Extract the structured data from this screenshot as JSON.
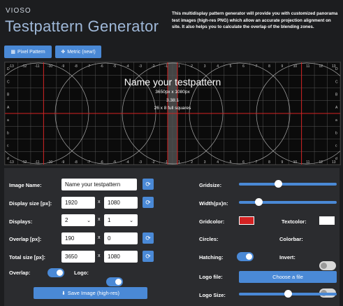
{
  "header": {
    "brand": "VIOSO",
    "title": "Testpattern Generator",
    "description": "This multidisplay pattern generator will provide you with customized panorama test images (high-res PNG) which allow an accurate projection alignment on site. It also helps you to calculate the overlap of the blending zones."
  },
  "mode_buttons": {
    "pixel": "Pixel Pattern",
    "metric": "Metric (new!)"
  },
  "preview": {
    "name": "Name your testpattern",
    "size": "3650px x 1080px",
    "ratio": "3.38:1",
    "squares": "26 x 8 full squares",
    "x_ticks": [
      "-13",
      "-12",
      "-11",
      "-10",
      "-9",
      "-8",
      "-7",
      "-6",
      "-5",
      "-4",
      "-3",
      "-2",
      "-1",
      "1",
      "2",
      "3",
      "4",
      "5",
      "6",
      "7",
      "8",
      "9",
      "10",
      "11",
      "12",
      "13"
    ],
    "y_ticks": [
      "D",
      "C",
      "B",
      "A",
      "a",
      "b",
      "c",
      "d"
    ]
  },
  "form": {
    "image_name_label": "Image Name:",
    "image_name_value": "Name your testpattern",
    "display_size_label": "Display size [px]:",
    "display_w": "1920",
    "display_h": "1080",
    "displays_label": "Displays:",
    "displays_x": "2",
    "displays_y": "1",
    "overlap_px_label": "Overlap [px]:",
    "overlap_x": "190",
    "overlap_y": "0",
    "total_size_label": "Total size [px]:",
    "total_w": "3650",
    "total_h": "1080",
    "overlap_label": "Overlap:",
    "logo_label": "Logo:",
    "x_sep": "x",
    "save_button": "Save Image (high-res)"
  },
  "settings": {
    "gridsize_label": "Gridsize:",
    "gridsize_value": 0.4,
    "width_label": "Width(px)n:",
    "width_value": 0.2,
    "gridcolor_label": "Gridcolor:",
    "gridcolor": "#d42222",
    "textcolor_label": "Textcolor:",
    "textcolor": "#ffffff",
    "circles_label": "Circles:",
    "colorbar_label": "Colorbar:",
    "hatching_label": "Hatching:",
    "invert_label": "Invert:",
    "logo_file_label": "Logo file:",
    "choose_file": "Choose a file",
    "logo_size_label": "Logo Size:",
    "logo_size_value": 0.5
  },
  "colors": {
    "accent": "#4a89d6",
    "grid_red": "#d42222"
  }
}
